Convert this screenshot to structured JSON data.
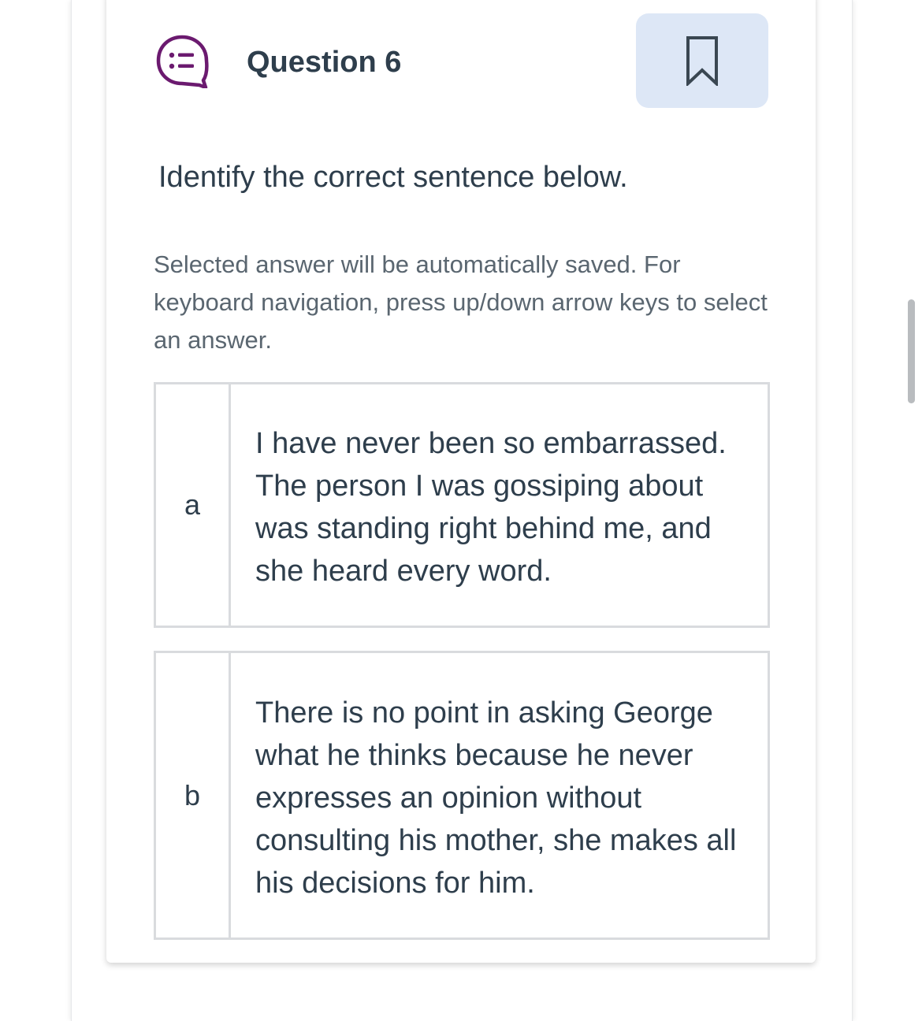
{
  "question": {
    "title": "Question 6",
    "prompt": "Identify the correct sentence below.",
    "instructions": "Selected answer will be automatically saved. For keyboard navigation, press up/down arrow keys to select an answer.",
    "icon": "question-list-icon",
    "bookmark_icon": "bookmark-icon"
  },
  "options": [
    {
      "letter": "a",
      "text": "I have never been so embarrassed. The person I was gossiping about was standing right behind me, and she heard every word."
    },
    {
      "letter": "b",
      "text": "There is no point in asking George what he thinks because he never expresses an opinion without consulting his mother, she makes all his decisions for him."
    }
  ],
  "colors": {
    "icon_accent": "#6b1a6f",
    "bookmark_bg": "#dde7f6",
    "text": "#2e3e4c",
    "muted_text": "#5a6670",
    "border": "#d9dbde"
  }
}
